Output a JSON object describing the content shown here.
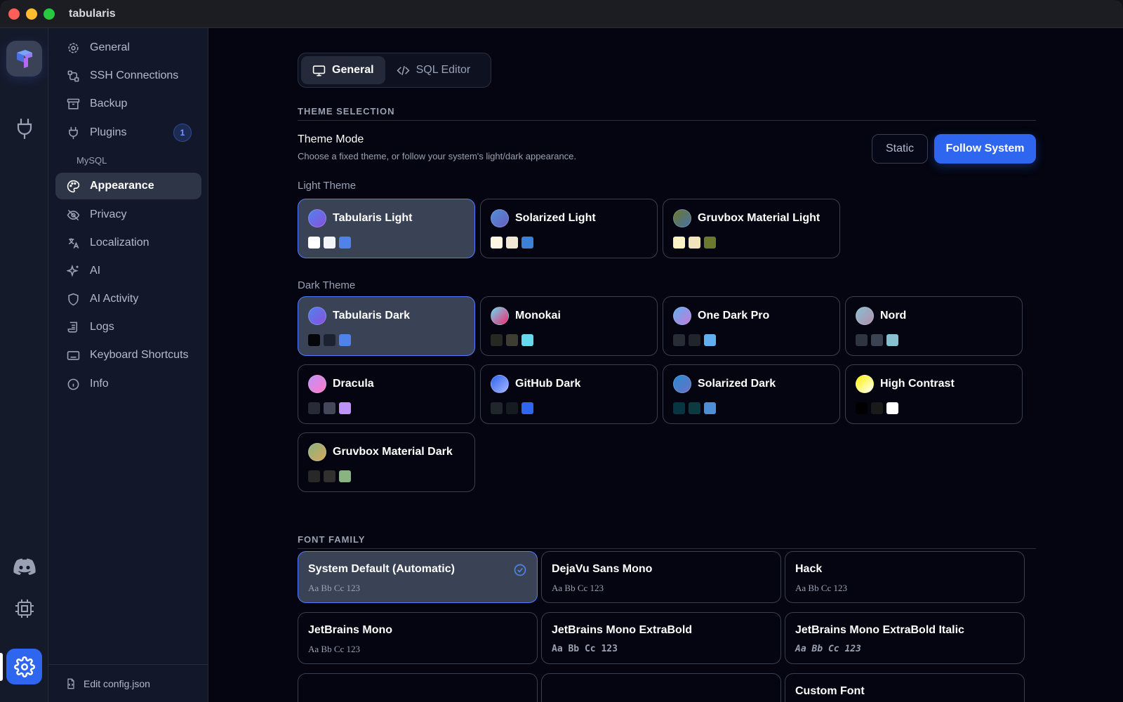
{
  "window": {
    "title": "tabularis"
  },
  "rail": {
    "icons": [
      "logo-icon",
      "plug-icon",
      "discord-icon",
      "cpu-icon",
      "settings-icon"
    ]
  },
  "sidebar": {
    "items": [
      {
        "label": "General",
        "icon": "gear-icon"
      },
      {
        "label": "SSH Connections",
        "icon": "ssh-icon"
      },
      {
        "label": "Backup",
        "icon": "archive-icon"
      },
      {
        "label": "Plugins",
        "icon": "plug-icon",
        "badge": "1"
      },
      {
        "label": "Appearance",
        "icon": "palette-icon",
        "active": true
      },
      {
        "label": "Privacy",
        "icon": "eye-off-icon"
      },
      {
        "label": "Localization",
        "icon": "translate-icon"
      },
      {
        "label": "AI",
        "icon": "sparkles-icon"
      },
      {
        "label": "AI Activity",
        "icon": "shield-icon"
      },
      {
        "label": "Logs",
        "icon": "scroll-icon"
      },
      {
        "label": "Keyboard Shortcuts",
        "icon": "keyboard-icon"
      },
      {
        "label": "Info",
        "icon": "info-icon"
      }
    ],
    "sub_item": "MySQL",
    "footer": "Edit config.json"
  },
  "tabs": [
    {
      "label": "General",
      "icon": "monitor-icon"
    },
    {
      "label": "SQL Editor",
      "icon": "code-icon"
    }
  ],
  "theme_section": {
    "title": "THEME SELECTION",
    "mode_label": "Theme Mode",
    "mode_desc": "Choose a fixed theme, or follow your system's light/dark appearance.",
    "static_label": "Static",
    "follow_label": "Follow System",
    "light_label": "Light Theme",
    "dark_label": "Dark Theme",
    "light_themes": [
      {
        "name": "Tabularis Light",
        "swatches": [
          "#ffffff",
          "#f3f4f7",
          "#4f83ea"
        ],
        "dot": "linear-gradient(135deg,#4f83ea,#8a4fe0)",
        "selected": true
      },
      {
        "name": "Solarized Light",
        "swatches": [
          "#fdf6e3",
          "#eee8d5",
          "#3b82d6"
        ],
        "dot": "linear-gradient(135deg,#4d8fd6,#6a5fc1)"
      },
      {
        "name": "Gruvbox Material Light",
        "swatches": [
          "#fbf1c7",
          "#f2e5bc",
          "#6c782e"
        ],
        "dot": "linear-gradient(135deg,#6c782e,#4571a8)"
      }
    ],
    "dark_themes": [
      {
        "name": "Tabularis Dark",
        "swatches": [
          "#05060c",
          "#1c2230",
          "#4f83ea"
        ],
        "dot": "linear-gradient(135deg,#4f83ea,#8a4fe0)",
        "selected": true
      },
      {
        "name": "Monokai",
        "swatches": [
          "#272822",
          "#3e3d32",
          "#66d9ef"
        ],
        "dot": "linear-gradient(135deg,#66d9ef,#f92672)"
      },
      {
        "name": "One Dark Pro",
        "swatches": [
          "#282c34",
          "#21252b",
          "#61afef"
        ],
        "dot": "linear-gradient(135deg,#61afef,#c678dd)"
      },
      {
        "name": "Nord",
        "swatches": [
          "#2e3440",
          "#3b4252",
          "#88c0d0"
        ],
        "dot": "linear-gradient(135deg,#88c0d0,#b48ead)"
      },
      {
        "name": "Dracula",
        "swatches": [
          "#282a36",
          "#44475a",
          "#bd93f9"
        ],
        "dot": "linear-gradient(135deg,#bd93f9,#ff79c6)"
      },
      {
        "name": "GitHub Dark",
        "swatches": [
          "#21262d",
          "#161b22",
          "#2f66f0"
        ],
        "dot": "linear-gradient(135deg,#2f66f0,#a5b4fc)"
      },
      {
        "name": "Solarized Dark",
        "swatches": [
          "#073642",
          "#0d3a40",
          "#4d8fd6"
        ],
        "dot": "linear-gradient(135deg,#268bd2,#6c71c4)"
      },
      {
        "name": "High Contrast",
        "swatches": [
          "#000000",
          "#1a1a1a",
          "#ffffff"
        ],
        "dot": "linear-gradient(135deg,#fff200,#ffffff)"
      },
      {
        "name": "Gruvbox Material Dark",
        "swatches": [
          "#282828",
          "#32302f",
          "#89b482"
        ],
        "dot": "linear-gradient(135deg,#89b482,#d8a657)"
      }
    ]
  },
  "font_section": {
    "title": "FONT FAMILY",
    "fonts": [
      {
        "name": "System Default (Automatic)",
        "sample": "Aa Bb Cc 123",
        "selected": true,
        "style": ""
      },
      {
        "name": "DejaVu Sans Mono",
        "sample": "Aa Bb Cc 123",
        "style": ""
      },
      {
        "name": "Hack",
        "sample": "Aa Bb Cc 123",
        "style": ""
      },
      {
        "name": "JetBrains Mono",
        "sample": "Aa Bb Cc 123",
        "style": ""
      },
      {
        "name": "JetBrains Mono ExtraBold",
        "sample": "Aa Bb Cc 123",
        "style": "mono-bold"
      },
      {
        "name": "JetBrains Mono ExtraBold Italic",
        "sample": "Aa Bb Cc 123",
        "style": "mono-bold-italic"
      }
    ],
    "partial_font": "Custom Font"
  },
  "colors": {
    "accent": "#2f66f0",
    "background": "#040510",
    "sidebar": "#121829"
  }
}
